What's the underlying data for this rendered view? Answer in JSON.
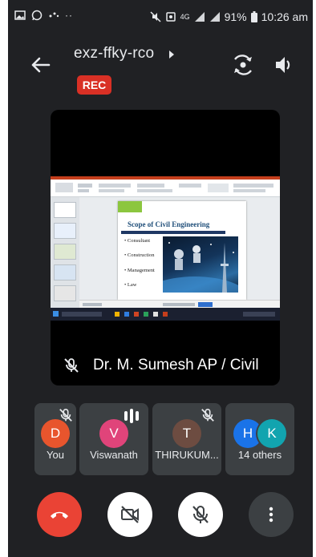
{
  "status_bar": {
    "battery": "91%",
    "time": "10:26 am",
    "network": "4G"
  },
  "header": {
    "meeting_code": "exz-ffky-rco",
    "rec_label": "REC"
  },
  "presentation": {
    "slide_title": "Scope of Civil Engineering",
    "slide_bullets": [
      "Consultant",
      "Construction",
      "Management",
      "Law"
    ],
    "presenter_name": "Dr. M. Sumesh AP / Civil"
  },
  "participants": [
    {
      "initial": "D",
      "name": "You",
      "color": "#e8552d",
      "muted": true
    },
    {
      "initial": "V",
      "name": "Viswanath",
      "color": "#e0447a",
      "muted": false,
      "speaking": true
    },
    {
      "initial": "T",
      "name": "THIRUKUM...",
      "color": "#6d4c41",
      "muted": true
    },
    {
      "initials": [
        "H",
        "K"
      ],
      "name": "14 others",
      "colors": [
        "#1a73e8",
        "#12a4af"
      ]
    }
  ],
  "controls": {
    "end_call_color": "#ea4335",
    "labels": [
      "end-call",
      "camera-off",
      "mic-off",
      "more-options"
    ]
  },
  "colors": {
    "background": "#202124",
    "tile": "#3c4043",
    "rec": "#d93025"
  }
}
